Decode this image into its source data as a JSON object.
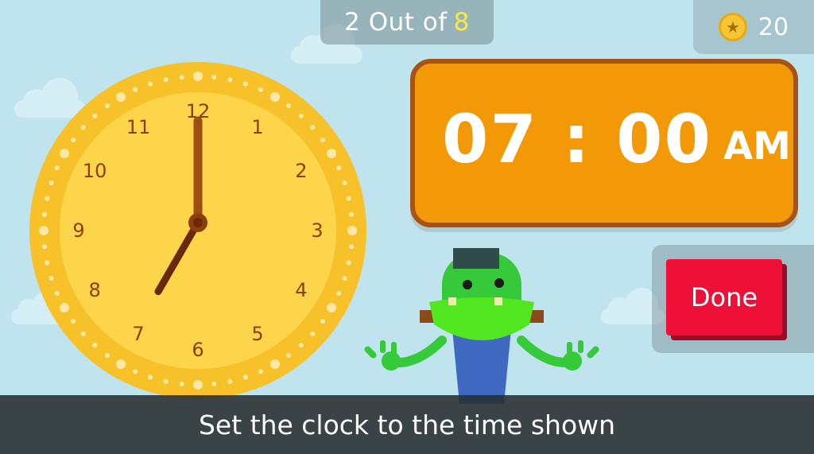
{
  "progress": {
    "current": "2 Out of",
    "total": "8"
  },
  "coins": {
    "count": "20",
    "icon": "star-coin-icon"
  },
  "clock": {
    "numbers": [
      "12",
      "1",
      "2",
      "3",
      "4",
      "5",
      "6",
      "7",
      "8",
      "9",
      "10",
      "11"
    ],
    "hour_hand_hour": 7,
    "minute_hand_minute": 0
  },
  "digital": {
    "hours": "07",
    "separator": ":",
    "minutes": "00",
    "ampm": "AM"
  },
  "done_label": "Done",
  "instruction": "Set the clock to the time shown",
  "colors": {
    "sky": "#bfe4ee",
    "clock_rim": "#f7c12a",
    "clock_face": "#fdd54a",
    "hands": "#8b3f10",
    "digital_bg": "#f39806",
    "digital_border": "#a55416",
    "done_button": "#ee1036",
    "progress_total": "#ffe83a"
  }
}
